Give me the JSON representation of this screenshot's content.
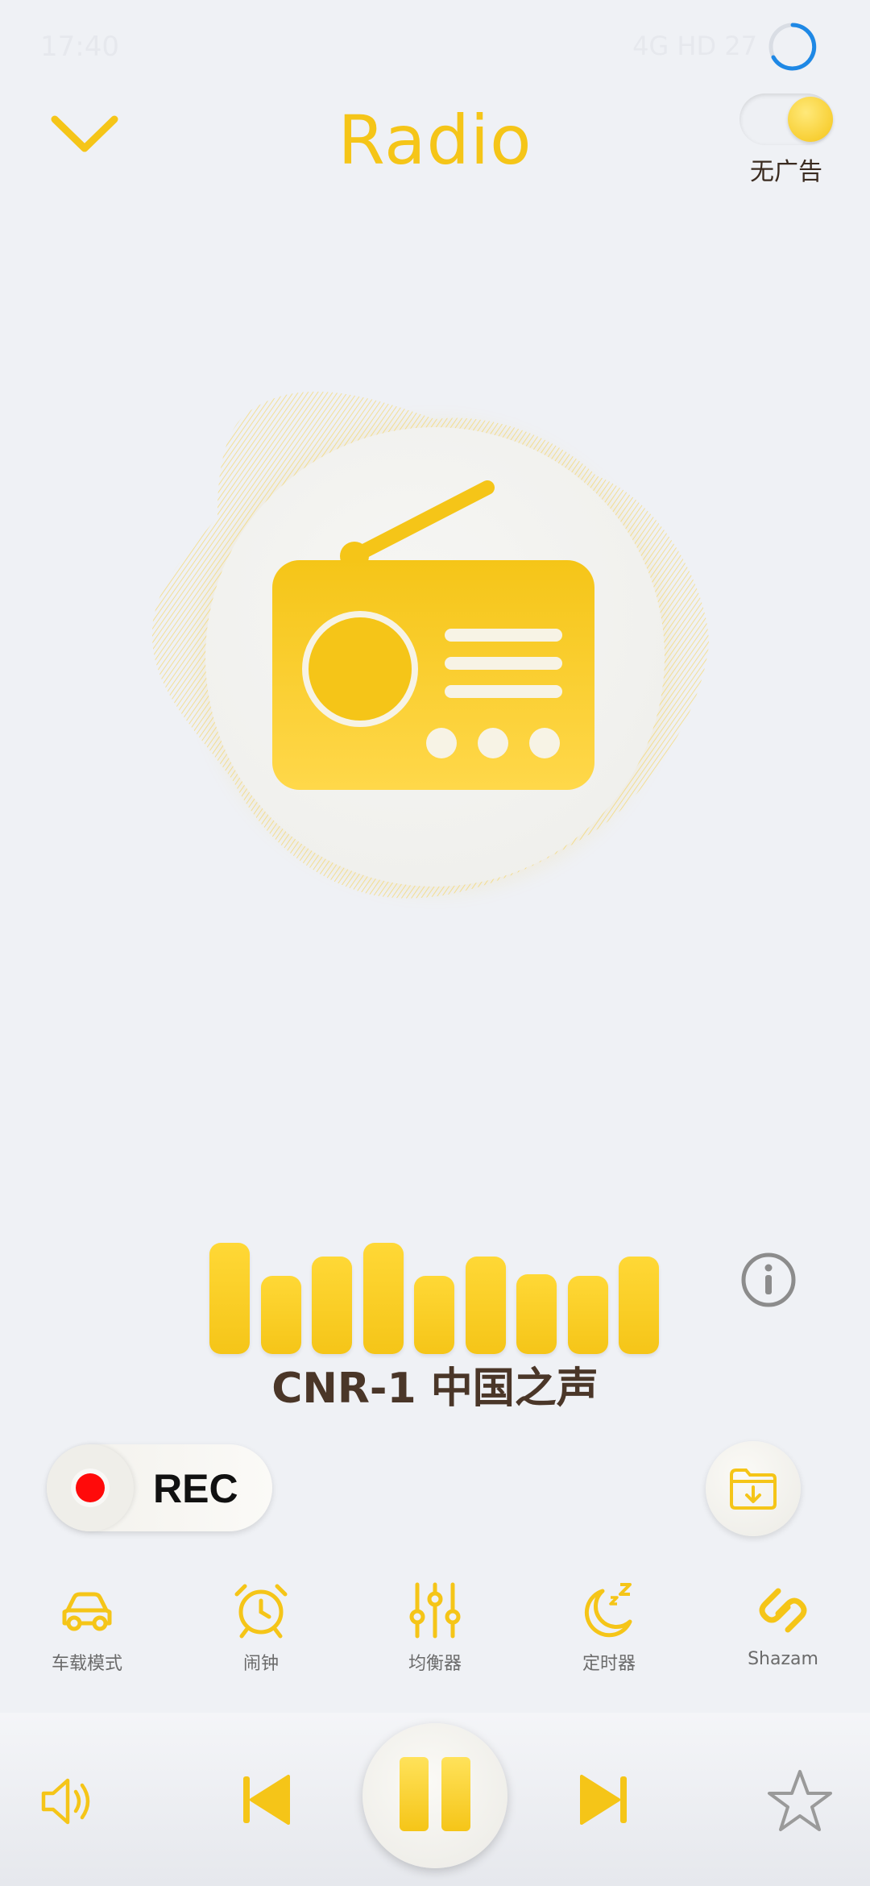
{
  "status": {
    "time": "17:40",
    "right_text": "4G HD 27"
  },
  "header": {
    "title": "Radio",
    "toggle_label": "无广告"
  },
  "station": {
    "name": "CNR-1 中国之声",
    "level_bars": [
      1.0,
      0.7,
      0.88,
      1.0,
      0.7,
      0.88,
      0.72,
      0.7,
      0.88
    ]
  },
  "rec": {
    "label": "REC"
  },
  "tools": [
    {
      "id": "car",
      "label": "车载模式",
      "icon": "car-icon"
    },
    {
      "id": "alarm",
      "label": "闹钟",
      "icon": "alarm-clock-icon"
    },
    {
      "id": "equalizer",
      "label": "均衡器",
      "icon": "equalizer-icon"
    },
    {
      "id": "timer",
      "label": "定时器",
      "icon": "sleep-timer-icon"
    },
    {
      "id": "shazam",
      "label": "Shazam",
      "icon": "shazam-icon"
    }
  ],
  "colors": {
    "accent": "#f5c518",
    "background": "#eff1f5",
    "station_text": "#4a3628",
    "rec_dot": "#ff0a0a"
  }
}
